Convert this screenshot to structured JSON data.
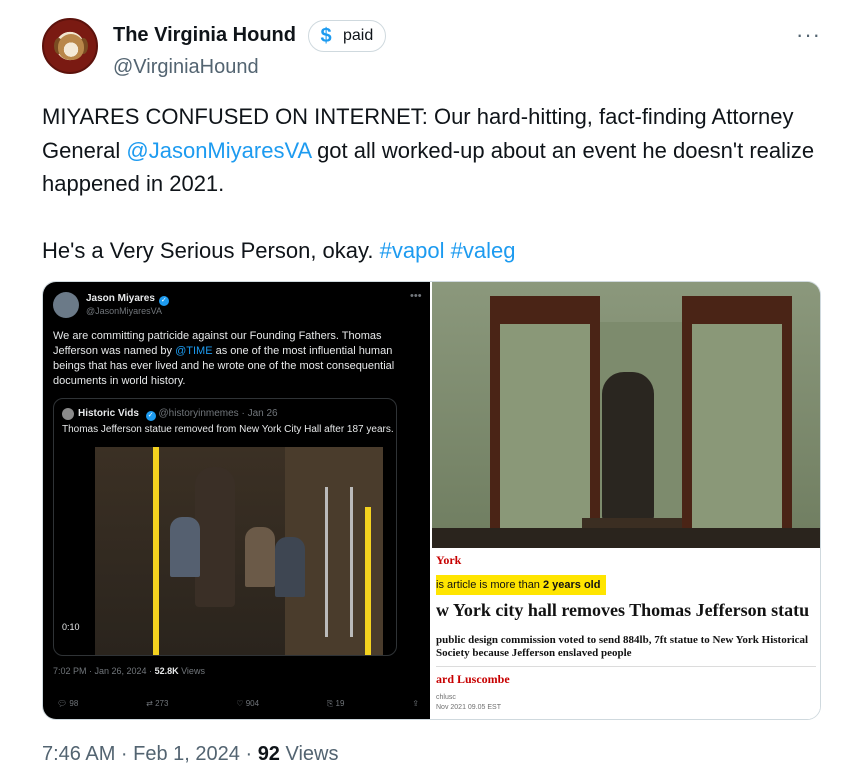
{
  "author": {
    "name": "The Virginia Hound",
    "handle": "@VirginiaHound",
    "badge_label": "paid",
    "badge_icon": "dollar-icon"
  },
  "more_icon": "···",
  "tweet": {
    "line1_pre": "MIYARES CONFUSED ON INTERNET: Our hard-hitting, fact-finding Attorney General ",
    "mention": "@JasonMiyaresVA",
    "line1_post": " got all worked-up about an event he doesn't realize happened in 2021.",
    "line2_pre": "He's a Very Serious Person, okay. ",
    "hashtag1": "#vapol",
    "hashtag2": "#valeg"
  },
  "embedded_tweet": {
    "name": "Jason Miyares",
    "handle": "@JasonMiyaresVA",
    "text_pre": "We are committing patricide against our Founding Fathers.  Thomas Jefferson was named by ",
    "text_mention": "@TIME",
    "text_post": " as one of the most influential human beings that has ever lived and he wrote one of the most consequential documents in world history.",
    "quote": {
      "name": "Historic Vids",
      "meta": "@historyinmemes · Jan 26",
      "text": "Thomas Jefferson statue removed from New York City Hall after 187 years.",
      "video_time": "0:10"
    },
    "date": "7:02 PM · Jan 26, 2024 · ",
    "views_count": "52.8K",
    "views_label": " Views",
    "actions": {
      "replies": "98",
      "reposts": "273",
      "likes": "904",
      "bookmarks": "19"
    }
  },
  "news_card": {
    "kicker": "York",
    "notice_pre": "is article is more than ",
    "notice_bold": "2 years old",
    "headline": "w York city hall removes Thomas Jefferson statu",
    "standfirst": "public design commission voted to send 884lb, 7ft statue to New York Historical Society because Jefferson enslaved people",
    "byline": "ard Luscombe",
    "meta_line1": "chlusc",
    "meta_line2": "Nov 2021 09.05 EST"
  },
  "footer": {
    "time": "7:46 AM · Feb 1, 2024 · ",
    "views_count": "92",
    "views_label": " Views"
  },
  "colors": {
    "link": "#1d9bf0",
    "text": "#0f1419",
    "muted": "#536471",
    "guardian_red": "#c70000",
    "notice_yellow": "#ffe500"
  }
}
